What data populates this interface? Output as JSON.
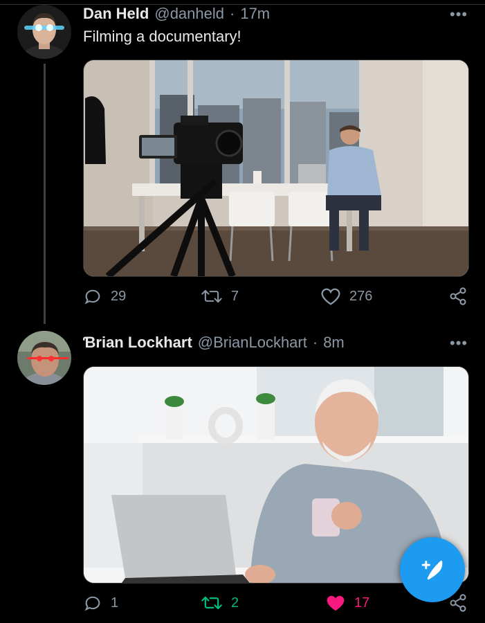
{
  "tweets": [
    {
      "name": "Dan Held",
      "handle": "@danheld",
      "separator": "·",
      "time": "17m",
      "text": "Filming a documentary!",
      "more": "•••",
      "reply_count": "29",
      "retweet_count": "7",
      "like_count": "276",
      "retweeted": false,
      "liked": false
    },
    {
      "name": "Ɓrian Lockhart",
      "handle": "@BrianLockhart",
      "separator": "·",
      "time": "8m",
      "text": "",
      "more": "•••",
      "reply_count": "1",
      "retweet_count": "2",
      "like_count": "17",
      "retweeted": true,
      "liked": true
    }
  ],
  "colors": {
    "background": "#000000",
    "text": "#e7e9ea",
    "muted": "#8b98a5",
    "retweet_active": "#00ba7c",
    "like_active": "#f91880",
    "accent": "#1d9bf0"
  },
  "icons": {
    "reply": "reply-icon",
    "retweet": "retweet-icon",
    "like": "heart-icon",
    "share": "share-icon",
    "compose": "compose-tweet-icon"
  }
}
